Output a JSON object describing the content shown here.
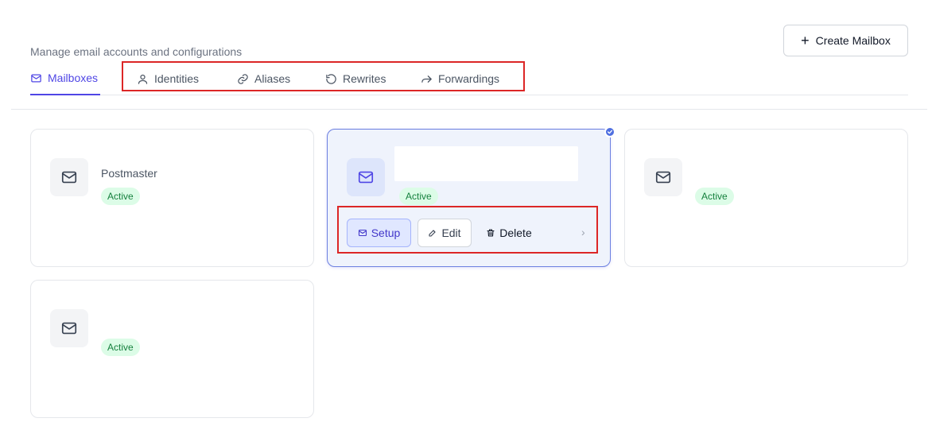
{
  "header": {
    "subtitle": "Manage email accounts and configurations",
    "create_button_label": "Create Mailbox"
  },
  "tabs": [
    {
      "label": "Mailboxes",
      "icon": "mail-icon",
      "active": true
    },
    {
      "label": "Identities",
      "icon": "user-icon",
      "active": false
    },
    {
      "label": "Aliases",
      "icon": "link-icon",
      "active": false
    },
    {
      "label": "Rewrites",
      "icon": "rotate-ccw-icon",
      "active": false
    },
    {
      "label": "Forwardings",
      "icon": "forward-arrow-icon",
      "active": false
    }
  ],
  "mailboxes": [
    {
      "name": "Postmaster",
      "status": "Active"
    },
    {
      "name": "",
      "status": "Active",
      "selected": true,
      "actions": {
        "setup": "Setup",
        "edit": "Edit",
        "delete": "Delete"
      }
    },
    {
      "name": "",
      "status": "Active"
    },
    {
      "name": "",
      "status": "Active"
    }
  ],
  "colors": {
    "accent": "#4f46e5",
    "highlight_box": "#dc2626",
    "active_badge_bg": "#dcfce7",
    "active_badge_text": "#15803d"
  }
}
